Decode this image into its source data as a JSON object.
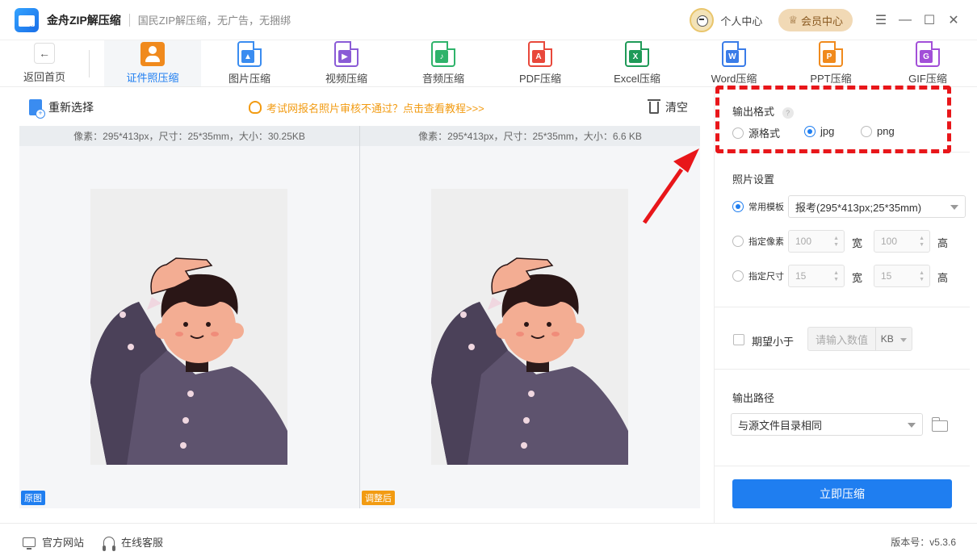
{
  "app": {
    "name": "金舟ZIP解压缩",
    "slogan": "国民ZIP解压缩，无广告，无捆绑",
    "user_center": "个人中心",
    "vip_center": "会员中心"
  },
  "window_controls": [
    "menu-icon",
    "minimize-icon",
    "maximize-icon",
    "close-icon"
  ],
  "toolbar": {
    "back_label": "返回首页",
    "tabs": [
      {
        "label": "证件照压缩",
        "icon": "id-photo-icon",
        "active": true
      },
      {
        "label": "图片压缩",
        "icon": "image-file-icon",
        "color": "#3a8cf0"
      },
      {
        "label": "视频压缩",
        "icon": "video-file-icon",
        "color": "#8a5bd6"
      },
      {
        "label": "音频压缩",
        "icon": "audio-file-icon",
        "color": "#2fb36b"
      },
      {
        "label": "PDF压缩",
        "icon": "pdf-file-icon",
        "color": "#e8483b"
      },
      {
        "label": "Excel压缩",
        "icon": "excel-file-icon",
        "color": "#1f9a58"
      },
      {
        "label": "Word压缩",
        "icon": "word-file-icon",
        "color": "#3a7ce8"
      },
      {
        "label": "PPT压缩",
        "icon": "ppt-file-icon",
        "color": "#f08a1d"
      },
      {
        "label": "GIF压缩",
        "icon": "gif-file-icon",
        "color": "#a24fd8"
      }
    ]
  },
  "work": {
    "reselect_label": "重新选择",
    "tip_text": "考试网报名照片审核不通过？点击查看教程>>>",
    "clear_label": "清空",
    "original": {
      "info": "像素：295*413px，尺寸：25*35mm，大小：30.25KB",
      "badge": "原图"
    },
    "adjusted": {
      "info": "像素：295*413px，尺寸：25*35mm，大小：6.6 KB",
      "badge": "调整后"
    }
  },
  "settings": {
    "output_format": {
      "label": "输出格式",
      "help": "?",
      "options": [
        "源格式",
        "jpg",
        "png"
      ],
      "selected": "jpg"
    },
    "photo": {
      "label": "照片设置",
      "template_label": "常用模板",
      "template_value": "报考(295*413px;25*35mm)",
      "pixel_label": "指定像素",
      "pixel_width": "100",
      "pixel_height": "100",
      "size_label": "指定尺寸",
      "size_width": "15",
      "size_height": "15",
      "width_unit": "宽",
      "height_unit": "高"
    },
    "expect": {
      "label": "期望小于",
      "placeholder": "请输入数值",
      "unit": "KB"
    },
    "output_path": {
      "label": "输出路径",
      "value": "与源文件目录相同"
    },
    "compress_button": "立即压缩"
  },
  "statusbar": {
    "website": "官方网站",
    "service": "在线客服",
    "version": "版本号：v5.3.6"
  },
  "colors": {
    "accent": "#1f7ef0",
    "tip": "#f29b12",
    "annotation": "#e8161a"
  }
}
